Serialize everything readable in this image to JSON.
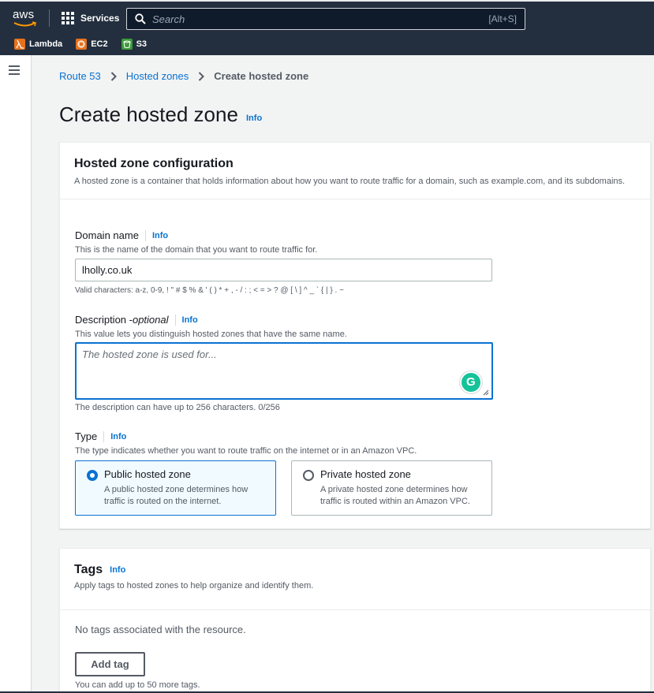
{
  "nav": {
    "logo": "aws",
    "services_label": "Services",
    "search_placeholder": "Search",
    "search_shortcut": "[Alt+S]",
    "favorites": [
      {
        "label": "Lambda",
        "icon": "lambda-icon"
      },
      {
        "label": "EC2",
        "icon": "ec2-icon"
      },
      {
        "label": "S3",
        "icon": "s3-icon"
      }
    ]
  },
  "breadcrumb": {
    "items": [
      "Route 53",
      "Hosted zones"
    ],
    "current": "Create hosted zone"
  },
  "page": {
    "title": "Create hosted zone",
    "info": "Info"
  },
  "config": {
    "title": "Hosted zone configuration",
    "description": "A hosted zone is a container that holds information about how you want to route traffic for a domain, such as example.com, and its subdomains.",
    "domain": {
      "label": "Domain name",
      "info": "Info",
      "description": "This is the name of the domain that you want to route traffic for.",
      "value": "lholly.co.uk",
      "constraint": "Valid characters: a-z, 0-9, ! \" # $ % & ' ( ) * + , - / : ; < = > ? @ [ \\ ] ^ _ ` { | } . ~"
    },
    "description_field": {
      "label": "Description - ",
      "label_optional": "optional",
      "info": "Info",
      "description": "This value lets you distinguish hosted zones that have the same name.",
      "placeholder": "The hosted zone is used for...",
      "value": "",
      "constraint": "The description can have up to 256 characters. 0/256"
    },
    "type": {
      "label": "Type",
      "info": "Info",
      "description": "The type indicates whether you want to route traffic on the internet or in an Amazon VPC.",
      "options": [
        {
          "title": "Public hosted zone",
          "description": "A public hosted zone determines how traffic is routed on the internet.",
          "selected": true
        },
        {
          "title": "Private hosted zone",
          "description": "A private hosted zone determines how traffic is routed within an Amazon VPC.",
          "selected": false
        }
      ]
    }
  },
  "tags": {
    "title": "Tags",
    "info": "Info",
    "description": "Apply tags to hosted zones to help organize and identify them.",
    "empty": "No tags associated with the resource.",
    "add_button": "Add tag",
    "hint": "You can add up to 50 more tags."
  },
  "colors": {
    "nav_bg": "#232f3e",
    "link": "#0972d3",
    "accent": "#0972d3",
    "grammarly": "#15c39a"
  }
}
